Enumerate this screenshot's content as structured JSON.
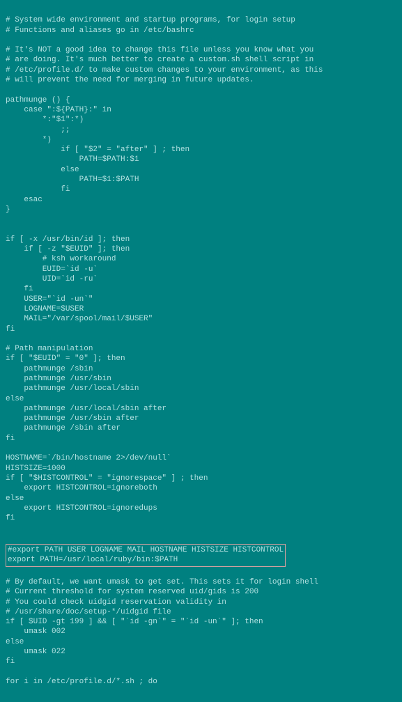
{
  "terminal": {
    "lines": [
      "# System wide environment and startup programs, for login setup",
      "# Functions and aliases go in /etc/bashrc",
      "",
      "# It's NOT a good idea to change this file unless you know what you",
      "# are doing. It's much better to create a custom.sh shell script in",
      "# /etc/profile.d/ to make custom changes to your environment, as this",
      "# will prevent the need for merging in future updates.",
      "",
      "pathmunge () {",
      "    case \":${PATH}:\" in",
      "        *:\"$1\":*)",
      "            ;;",
      "        *)",
      "            if [ \"$2\" = \"after\" ] ; then",
      "                PATH=$PATH:$1",
      "            else",
      "                PATH=$1:$PATH",
      "            fi",
      "    esac",
      "}",
      "",
      "",
      "if [ -x /usr/bin/id ]; then",
      "    if [ -z \"$EUID\" ]; then",
      "        # ksh workaround",
      "        EUID=`id -u`",
      "        UID=`id -ru`",
      "    fi",
      "    USER=\"`id -un`\"",
      "    LOGNAME=$USER",
      "    MAIL=\"/var/spool/mail/$USER\"",
      "fi",
      "",
      "# Path manipulation",
      "if [ \"$EUID\" = \"0\" ]; then",
      "    pathmunge /sbin",
      "    pathmunge /usr/sbin",
      "    pathmunge /usr/local/sbin",
      "else",
      "    pathmunge /usr/local/sbin after",
      "    pathmunge /usr/sbin after",
      "    pathmunge /sbin after",
      "fi",
      "",
      "HOSTNAME=`/bin/hostname 2>/dev/null`",
      "HISTSIZE=1000",
      "if [ \"$HISTCONTROL\" = \"ignorespace\" ] ; then",
      "    export HISTCONTROL=ignoreboth",
      "else",
      "    export HISTCONTROL=ignoredups",
      "fi",
      ""
    ],
    "highlight": [
      "#export PATH USER LOGNAME MAIL HOSTNAME HISTSIZE HISTCONTROL",
      "export PATH=/usr/local/ruby/bin:$PATH"
    ],
    "lines2": [
      "",
      "# By default, we want umask to get set. This sets it for login shell",
      "# Current threshold for system reserved uid/gids is 200",
      "# You could check uidgid reservation validity in",
      "# /usr/share/doc/setup-*/uidgid file",
      "if [ $UID -gt 199 ] && [ \"`id -gn`\" = \"`id -un`\" ]; then",
      "    umask 002",
      "else",
      "    umask 022",
      "fi",
      "",
      "for i in /etc/profile.d/*.sh ; do"
    ]
  }
}
